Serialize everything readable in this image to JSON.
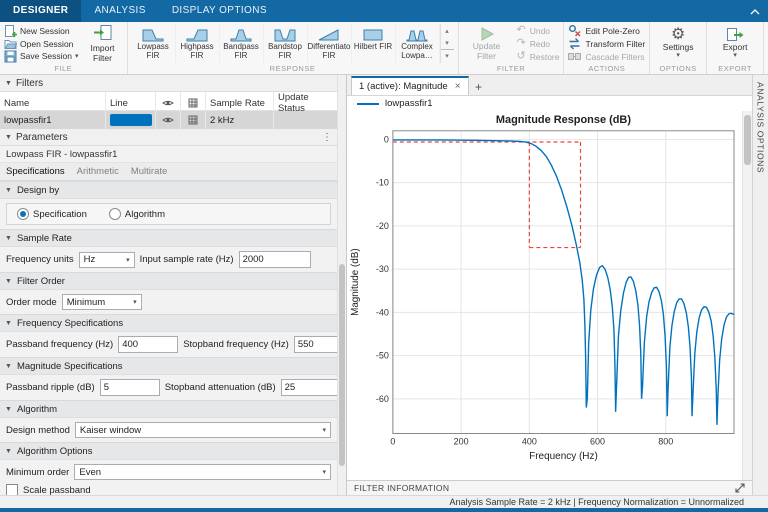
{
  "colors": {
    "accent": "#0072BD",
    "toolstrip_blue": "#1269a4",
    "mask_red": "#e8453c"
  },
  "tabbar": {
    "tabs": [
      {
        "label": "DESIGNER"
      },
      {
        "label": "ANALYSIS"
      },
      {
        "label": "DISPLAY OPTIONS"
      }
    ]
  },
  "ribbon": {
    "file": {
      "section": "FILE",
      "new_label": "New Session",
      "open_label": "Open Session",
      "save_label": "Save Session",
      "import_label": "Import Filter"
    },
    "response": {
      "section": "RESPONSE",
      "items": [
        "Lowpass FIR",
        "Highpass FIR",
        "Bandpass FIR",
        "Bandstop FIR",
        "Differentiator FIR",
        "Hilbert FIR",
        "Complex Lowpa…"
      ]
    },
    "filter": {
      "section": "FILTER",
      "update_label": "Update Filter",
      "undo_label": "Undo",
      "redo_label": "Redo",
      "restore_label": "Restore"
    },
    "actions": {
      "section": "ACTIONS",
      "items": [
        "Edit Pole-Zero",
        "Transform Filter",
        "Cascade Filters"
      ]
    },
    "options": {
      "section": "OPTIONS",
      "settings_label": "Settings"
    },
    "export": {
      "section": "EXPORT",
      "export_label": "Export"
    }
  },
  "filters_panel": {
    "title": "Filters",
    "columns": {
      "name": "Name",
      "line": "Line",
      "sample_rate": "Sample Rate",
      "update_status": "Update Status"
    },
    "rows": [
      {
        "name": "lowpassfir1",
        "line_color": "#0072BD",
        "sample_rate": "2 kHz",
        "update_status": ""
      }
    ]
  },
  "parameters_panel": {
    "title": "Parameters",
    "subtitle": "Lowpass FIR - lowpassfir1",
    "tabs": [
      "Specifications",
      "Arithmetic",
      "Multirate"
    ],
    "design_by": {
      "title": "Design by",
      "radio_specification": "Specification",
      "radio_algorithm": "Algorithm",
      "selected": "Specification"
    },
    "sample_rate": {
      "title": "Sample Rate",
      "frequency_units_label": "Frequency units",
      "frequency_units_value": "Hz",
      "input_rate_label": "Input sample rate (Hz)",
      "input_rate_value": "2000"
    },
    "filter_order": {
      "title": "Filter Order",
      "order_mode_label": "Order mode",
      "order_mode_value": "Minimum"
    },
    "frequency_specifications": {
      "title": "Frequency Specifications",
      "passband_label": "Passband frequency (Hz)",
      "passband_value": "400",
      "stopband_label": "Stopband frequency (Hz)",
      "stopband_value": "550"
    },
    "magnitude_specifications": {
      "title": "Magnitude Specifications",
      "ripple_label": "Passband ripple (dB)",
      "ripple_value": "5",
      "attenuation_label": "Stopband attenuation (dB)",
      "attenuation_value": "25"
    },
    "algorithm": {
      "title": "Algorithm",
      "method_label": "Design method",
      "method_value": "Kaiser window"
    },
    "algorithm_options": {
      "title": "Algorithm Options",
      "min_order_label": "Minimum order",
      "min_order_value": "Even",
      "scale_passband_label": "Scale passband",
      "scale_passband_checked": false
    }
  },
  "plot_panel": {
    "tab_label": "1 (active): Magnitude",
    "close_glyph": "×",
    "add_tab_glyph": "+",
    "legend": "lowpassfir1",
    "filter_information": "FILTER INFORMATION"
  },
  "analysis_options_label": "ANALYSIS OPTIONS",
  "status_bar": {
    "text": "Analysis Sample Rate = 2 kHz | Frequency Normalization = Unnormalized"
  },
  "chart_data": {
    "type": "line",
    "title": "Magnitude Response (dB)",
    "xlabel": "Frequency (Hz)",
    "ylabel": "Magnitude (dB)",
    "xlim": [
      0,
      1000
    ],
    "ylim": [
      -68,
      2
    ],
    "xticks": [
      0,
      200,
      400,
      600,
      800,
      1000
    ],
    "xtick_labels": [
      "0",
      "200",
      "400",
      "600",
      "800",
      ""
    ],
    "yticks": [
      0,
      -10,
      -20,
      -30,
      -40,
      -50,
      -60
    ],
    "grid": true,
    "legend_position": "top-left-docked",
    "spec_mask": {
      "color": "#e8453c",
      "style": "dashed",
      "segments": [
        [
          [
            0,
            -0.6
          ],
          [
            550,
            -0.6
          ]
        ],
        [
          [
            400,
            -0.6
          ],
          [
            400,
            -25
          ]
        ],
        [
          [
            550,
            -0.6
          ],
          [
            550,
            -25
          ]
        ],
        [
          [
            400,
            -25
          ],
          [
            550,
            -25
          ]
        ]
      ]
    },
    "series": [
      {
        "name": "lowpassfir1",
        "color": "#0072BD",
        "points": [
          [
            0,
            -0.1
          ],
          [
            60,
            -0.1
          ],
          [
            120,
            -0.12
          ],
          [
            180,
            -0.15
          ],
          [
            240,
            -0.2
          ],
          [
            300,
            -0.28
          ],
          [
            340,
            -0.35
          ],
          [
            370,
            -0.45
          ],
          [
            390,
            -0.6
          ],
          [
            405,
            -0.95
          ],
          [
            420,
            -1.6
          ],
          [
            435,
            -2.6
          ],
          [
            450,
            -4
          ],
          [
            465,
            -6
          ],
          [
            480,
            -8.6
          ],
          [
            495,
            -11.8
          ],
          [
            510,
            -15.6
          ],
          [
            525,
            -20
          ],
          [
            538,
            -24.5
          ],
          [
            548,
            -28.5
          ],
          [
            555,
            -32.5
          ],
          [
            560,
            -37
          ],
          [
            563,
            -43
          ],
          [
            565,
            -50
          ],
          [
            567,
            -62
          ],
          [
            570,
            -60
          ],
          [
            574,
            -47
          ],
          [
            580,
            -39.5
          ],
          [
            588,
            -34.5
          ],
          [
            597,
            -31.3
          ],
          [
            606,
            -29.6
          ],
          [
            614,
            -29.2
          ],
          [
            622,
            -30
          ],
          [
            630,
            -32
          ],
          [
            637,
            -34.8
          ],
          [
            643,
            -38.5
          ],
          [
            648,
            -44
          ],
          [
            651,
            -52
          ],
          [
            653,
            -63
          ],
          [
            656,
            -56
          ],
          [
            661,
            -45.5
          ],
          [
            668,
            -39.5
          ],
          [
            676,
            -35.5
          ],
          [
            684,
            -33
          ],
          [
            691,
            -31.9
          ],
          [
            698,
            -31.8
          ],
          [
            705,
            -32.8
          ],
          [
            712,
            -35
          ],
          [
            718,
            -38.2
          ],
          [
            723,
            -43
          ],
          [
            727,
            -50
          ],
          [
            729,
            -60
          ],
          [
            732,
            -57
          ],
          [
            737,
            -47
          ],
          [
            744,
            -41
          ],
          [
            751,
            -37.5
          ],
          [
            759,
            -35.3
          ],
          [
            766,
            -34.3
          ],
          [
            773,
            -34.2
          ],
          [
            780,
            -35.2
          ],
          [
            787,
            -37.3
          ],
          [
            793,
            -40.5
          ],
          [
            798,
            -45.5
          ],
          [
            802,
            -53
          ],
          [
            804,
            -64
          ],
          [
            807,
            -57
          ],
          [
            812,
            -48
          ],
          [
            818,
            -43
          ],
          [
            825,
            -39.8
          ],
          [
            832,
            -37.8
          ],
          [
            839,
            -36.9
          ],
          [
            846,
            -36.9
          ],
          [
            853,
            -37.9
          ],
          [
            860,
            -40
          ],
          [
            866,
            -43.3
          ],
          [
            871,
            -48
          ],
          [
            875,
            -55
          ],
          [
            877,
            -64
          ],
          [
            880,
            -58
          ],
          [
            885,
            -49.5
          ],
          [
            891,
            -44.5
          ],
          [
            898,
            -41.2
          ],
          [
            905,
            -39.4
          ],
          [
            912,
            -38.7
          ],
          [
            919,
            -38.8
          ],
          [
            926,
            -39.9
          ],
          [
            933,
            -42
          ],
          [
            939,
            -45.5
          ],
          [
            944,
            -50.5
          ],
          [
            948,
            -58
          ],
          [
            950,
            -66
          ],
          [
            953,
            -59
          ],
          [
            958,
            -51
          ],
          [
            964,
            -46
          ],
          [
            971,
            -42.8
          ],
          [
            978,
            -41
          ],
          [
            985,
            -40.3
          ],
          [
            992,
            -40.2
          ],
          [
            1000,
            -40.5
          ]
        ]
      }
    ]
  }
}
